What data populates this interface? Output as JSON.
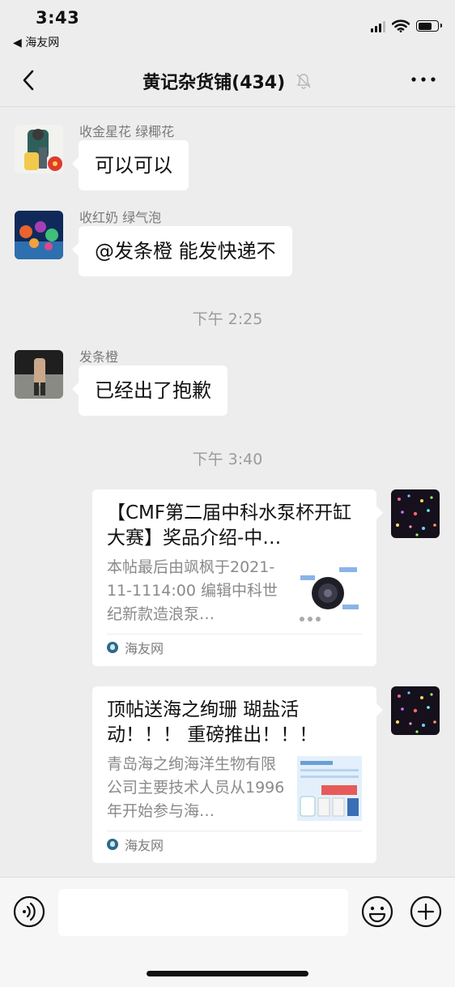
{
  "status_bar": {
    "time": "3:43",
    "back_app": "◀ 海友网"
  },
  "header": {
    "title": "黄记杂货铺(434)",
    "muted": true
  },
  "messages": [
    {
      "sender": "收金星花  绿椰花",
      "text": "可以可以"
    },
    {
      "sender": "收红奶 绿气泡",
      "text": "@发条橙 能发快递不"
    },
    {
      "timestamp": "下午 2:25"
    },
    {
      "sender": "发条橙",
      "text": "已经出了抱歉"
    },
    {
      "timestamp": "下午 3:40"
    }
  ],
  "cards": [
    {
      "title": "【CMF第二届中科水泵杯开缸大赛】奖品介绍-中…",
      "description": "本帖最后由飒枫于2021-11-1114:00 编辑中科世纪新款造浪泵…",
      "source": "海友网"
    },
    {
      "title": "顶帖送海之绚珊 瑚盐活动！！！ 重磅推出！！！",
      "description": "青岛海之绚海洋生物有限公司主要技术人员从1996年开始参与海…",
      "source": "海友网"
    }
  ],
  "input": {
    "placeholder": ""
  },
  "icons": {
    "back": "chevron-left-icon",
    "mute": "bell-slash-icon",
    "more": "ellipsis-icon",
    "voice": "voice-icon",
    "emoji": "emoji-icon",
    "plus": "plus-icon"
  }
}
